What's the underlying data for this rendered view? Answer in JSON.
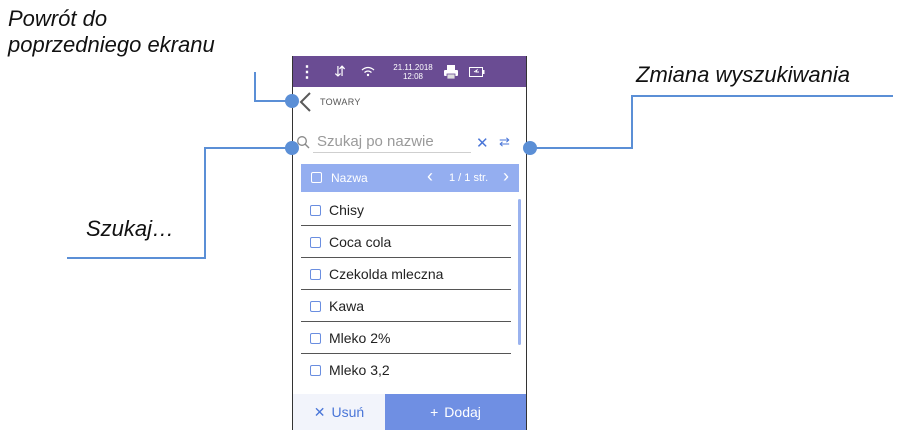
{
  "callouts": {
    "back_line1": "Powrót do",
    "back_line2": "poprzedniego ekranu",
    "search_mode": "Zmiana wyszukiwania",
    "search": "Szukaj…"
  },
  "statusbar": {
    "date": "21.11.2018",
    "time": "12:08"
  },
  "header": {
    "title": "TOWARY"
  },
  "search": {
    "placeholder": "Szukaj po nazwie"
  },
  "list_header": {
    "column_label": "Nazwa",
    "page_indicator": "1 / 1 str."
  },
  "items": [
    {
      "label": "Chisy"
    },
    {
      "label": "Coca cola"
    },
    {
      "label": "Czekolda mleczna"
    },
    {
      "label": "Kawa"
    },
    {
      "label": "Mleko 2%"
    },
    {
      "label": "Mleko 3,2"
    }
  ],
  "buttons": {
    "delete_label": "Usuń",
    "add_label": "Dodaj"
  },
  "icons": {
    "menu": "more-vertical-icon",
    "usb": "usb-icon",
    "wifi": "wifi-icon",
    "printer": "printer-icon",
    "battery": "battery-icon",
    "back": "chevron-left-icon",
    "search": "search-icon",
    "clear": "close-icon",
    "swap": "swap-arrows-icon",
    "prev": "chevron-left-icon",
    "next": "chevron-right-icon",
    "delete": "close-icon",
    "add": "plus-icon"
  },
  "colors": {
    "statusbar": "#6a4c93",
    "accent": "#4a76d8",
    "list_header": "#94aef0",
    "add_button": "#6f8fe3",
    "callout_line": "#5b8fd6"
  }
}
